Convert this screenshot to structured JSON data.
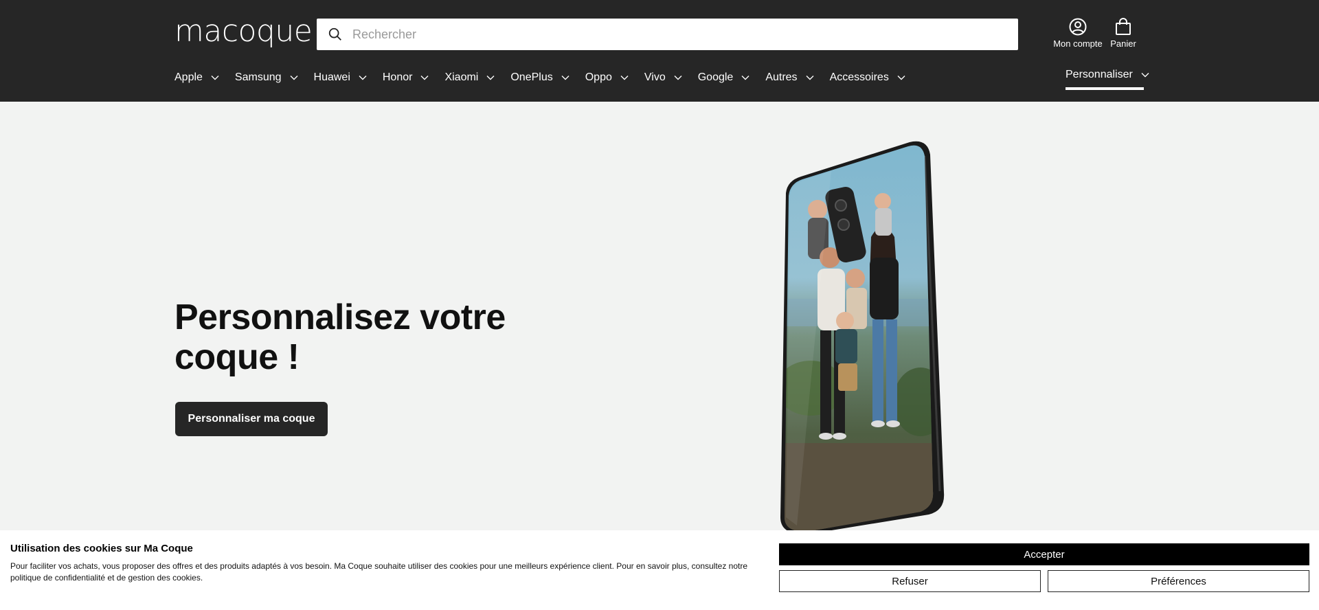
{
  "header": {
    "logo": "macoque",
    "search_placeholder": "Rechercher",
    "account_label": "Mon compte",
    "cart_label": "Panier"
  },
  "nav": {
    "items": [
      {
        "label": "Apple"
      },
      {
        "label": "Samsung"
      },
      {
        "label": "Huawei"
      },
      {
        "label": "Honor"
      },
      {
        "label": "Xiaomi"
      },
      {
        "label": "OnePlus"
      },
      {
        "label": "Oppo"
      },
      {
        "label": "Vivo"
      },
      {
        "label": "Google"
      },
      {
        "label": "Autres"
      },
      {
        "label": "Accessoires"
      }
    ],
    "right_item": "Personnaliser"
  },
  "hero": {
    "title": "Personnalisez votre coque !",
    "cta_label": "Personnaliser ma coque"
  },
  "cookie_banner": {
    "title": "Utilisation des cookies sur Ma Coque",
    "text": "Pour faciliter vos achats, vous proposer des offres et des produits adaptés à vos besoin. Ma Coque souhaite utiliser des cookies pour une meilleurs expérience client. Pour en savoir plus, consultez notre politique de confidentialité et de gestion des cookies.",
    "accept_label": "Accepter",
    "refuse_label": "Refuser",
    "preferences_label": "Préférences"
  },
  "colors": {
    "header_bg": "#262626",
    "page_bg": "#f2f3f2",
    "cta_bg": "#262626",
    "accept_bg": "#000000"
  }
}
